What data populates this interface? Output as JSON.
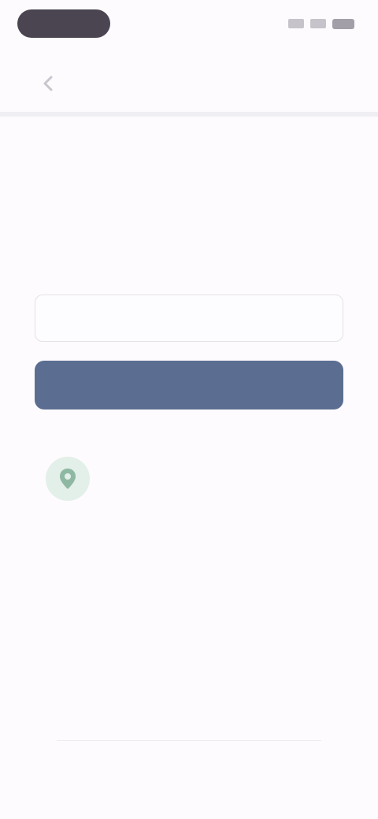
{
  "status_bar": {
    "time": "",
    "icons": [
      "signal-icon",
      "wifi-icon",
      "battery-icon"
    ]
  },
  "top_bar": {
    "back_icon": "chevron-left-icon",
    "title": ""
  },
  "main": {
    "headline": "",
    "subtext": "",
    "field_label": "",
    "input": {
      "value": "",
      "placeholder": ""
    },
    "continue_label": ""
  },
  "info_card": {
    "icon": "map-pin-icon",
    "title": "",
    "body": ""
  },
  "footer": {
    "text": "",
    "link": ""
  },
  "colors": {
    "primary_button": "#5b6e91",
    "background": "#fdfbfd",
    "info_icon_bg": "#e3efe9"
  }
}
